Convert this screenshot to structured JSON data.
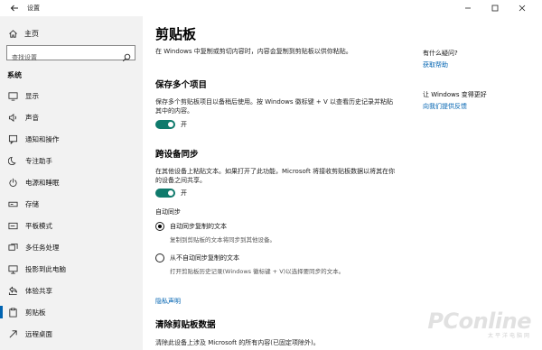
{
  "window": {
    "title": "设置",
    "controls": [
      "minimize-icon",
      "maximize-icon",
      "close-icon"
    ]
  },
  "sidebar": {
    "home_label": "主页",
    "search_placeholder": "查找设置",
    "section_title": "系统",
    "items": [
      {
        "label": "显示",
        "icon": "display-icon"
      },
      {
        "label": "声音",
        "icon": "sound-icon"
      },
      {
        "label": "通知和操作",
        "icon": "notification-icon"
      },
      {
        "label": "专注助手",
        "icon": "moon-icon"
      },
      {
        "label": "电源和睡眠",
        "icon": "power-icon"
      },
      {
        "label": "存储",
        "icon": "storage-icon"
      },
      {
        "label": "平板模式",
        "icon": "tablet-icon"
      },
      {
        "label": "多任务处理",
        "icon": "multitask-icon"
      },
      {
        "label": "投影到此电脑",
        "icon": "project-icon"
      },
      {
        "label": "体验共享",
        "icon": "share-icon"
      },
      {
        "label": "剪贴板",
        "icon": "clipboard-icon",
        "active": true
      },
      {
        "label": "远程桌面",
        "icon": "remote-icon"
      }
    ]
  },
  "main": {
    "title": "剪贴板",
    "intro": "在 Windows 中复制或剪切内容时，内容会复制到剪贴板以供你粘贴。",
    "history": {
      "heading": "保存多个项目",
      "desc": "保存多个剪贴板项目以备稍后使用。按 Windows 徽标键 + V 以查看历史记录并粘贴其中的内容。",
      "toggle_state": "开"
    },
    "sync": {
      "heading": "跨设备同步",
      "desc": "在其他设备上粘贴文本。如果打开了此功能，Microsoft 将接收剪贴板数据以将其在你的设备之间共享。",
      "toggle_state": "开",
      "auto_sync_label": "自动同步",
      "option1_label": "自动同步复制的文本",
      "option1_desc": "复制到剪贴板的文本将同步到其他设备。",
      "option2_label": "从不自动同步复制的文本",
      "option2_desc": "打开剪贴板历史记录(Windows 徽标键 + V)以选择要同步的文本。",
      "selected_option": 1
    },
    "privacy_link": "隐私声明",
    "clear": {
      "heading": "清除剪贴板数据",
      "desc": "清除此设备上涉及 Microsoft 的所有内容(已固定项除外)。"
    }
  },
  "aside": {
    "question": "有什么疑问?",
    "help_link": "获取帮助",
    "improve": "让 Windows 变得更好",
    "feedback_link": "向我们提供反馈"
  },
  "watermark": {
    "main": "PConline",
    "sub": "太平洋电脑网"
  },
  "colors": {
    "accent": "#0063b1",
    "toggle": "#0f7a6c",
    "sidebar_bg": "#f2f2f2"
  }
}
